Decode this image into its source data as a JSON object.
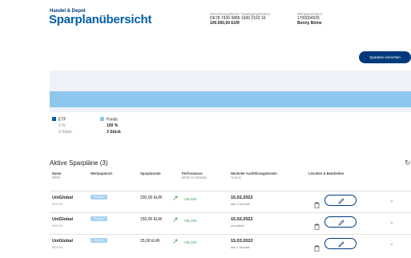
{
  "header": {
    "breadcrumb": "Handel & Depot",
    "title": "Sparplanübersicht",
    "account_label": "Verrechnungskonto / Sparlagerguthaben",
    "account_number": "DE78 7426 9886 1600 2162 16",
    "account_balance": "100.000,00 EUR",
    "owner_label": "Wertpapierdepot",
    "owner_number": "1700004526",
    "owner_name": "Benny Böme"
  },
  "actions": {
    "set_up_plan": "Sparplan einrichten"
  },
  "allocation": {
    "items": [
      {
        "label": "ETF",
        "percent": "0 %",
        "count": "0 Stück",
        "color": "#005ea8"
      },
      {
        "label": "Fonds",
        "percent": "100 %",
        "count": "3 Stück",
        "color": "#8ec7ee"
      }
    ]
  },
  "section": {
    "title": "Aktive Sparpläne (3)"
  },
  "table": {
    "headers": {
      "name": "Name",
      "name_sub": "WKN",
      "type": "Wertpapierart",
      "amount": "Sparplanrate",
      "performance": "Performance",
      "performance_sub": "letzte 12 Monate",
      "next_date": "Nächster Ausführungstermin",
      "next_date_sub": "Turnus",
      "actions": "Löschen & Bearbeiten"
    },
    "rows": [
      {
        "name": "UniGlobal",
        "isin": "849105",
        "type": "Fonds",
        "amount": "200,00 EUR",
        "performance": "+26,13%",
        "date": "15.02.2022",
        "frequency": "alle 3 Monate"
      },
      {
        "name": "UniGlobal",
        "isin": "849105",
        "type": "Fonds",
        "amount": "150,00 EUR",
        "performance": "+26,13%",
        "date": "15.02.2022",
        "frequency": "monatlich"
      },
      {
        "name": "UniGlobal",
        "isin": "849105",
        "type": "Fonds",
        "amount": "25,00 EUR",
        "performance": "+26,13%",
        "date": "15.03.2022",
        "frequency": "alle 2 Monate"
      }
    ]
  }
}
